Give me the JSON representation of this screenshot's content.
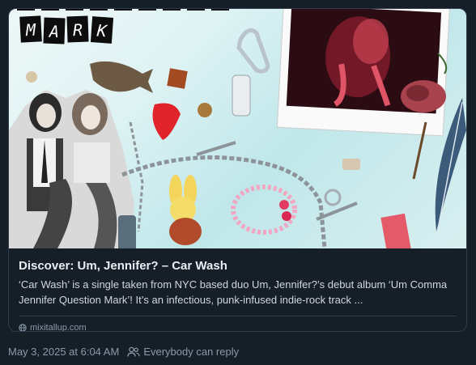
{
  "link_card": {
    "image": {
      "description_icon": "collage-image",
      "letter_tiles": [
        "M",
        "A",
        "R",
        "K"
      ]
    },
    "title": "Discover: Um, Jennifer? – Car Wash",
    "description": "‘Car Wash’ is a single taken from NYC based duo Um, Jennifer?’s debut album ‘Um Comma Jennifer Question Mark’! It’s an infectious, punk-infused indie-rock track ...",
    "domain": "mixitallup.com",
    "domain_icon": "globe-icon"
  },
  "post_meta": {
    "timestamp": "May 3, 2025 at 6:04 AM",
    "reply_setting": "Everybody can reply",
    "reply_icon": "people-icon"
  },
  "colors": {
    "background": "#161e27",
    "border": "#2e3c4b",
    "muted_text": "#8a9aab",
    "title_text": "#e8edf2"
  }
}
